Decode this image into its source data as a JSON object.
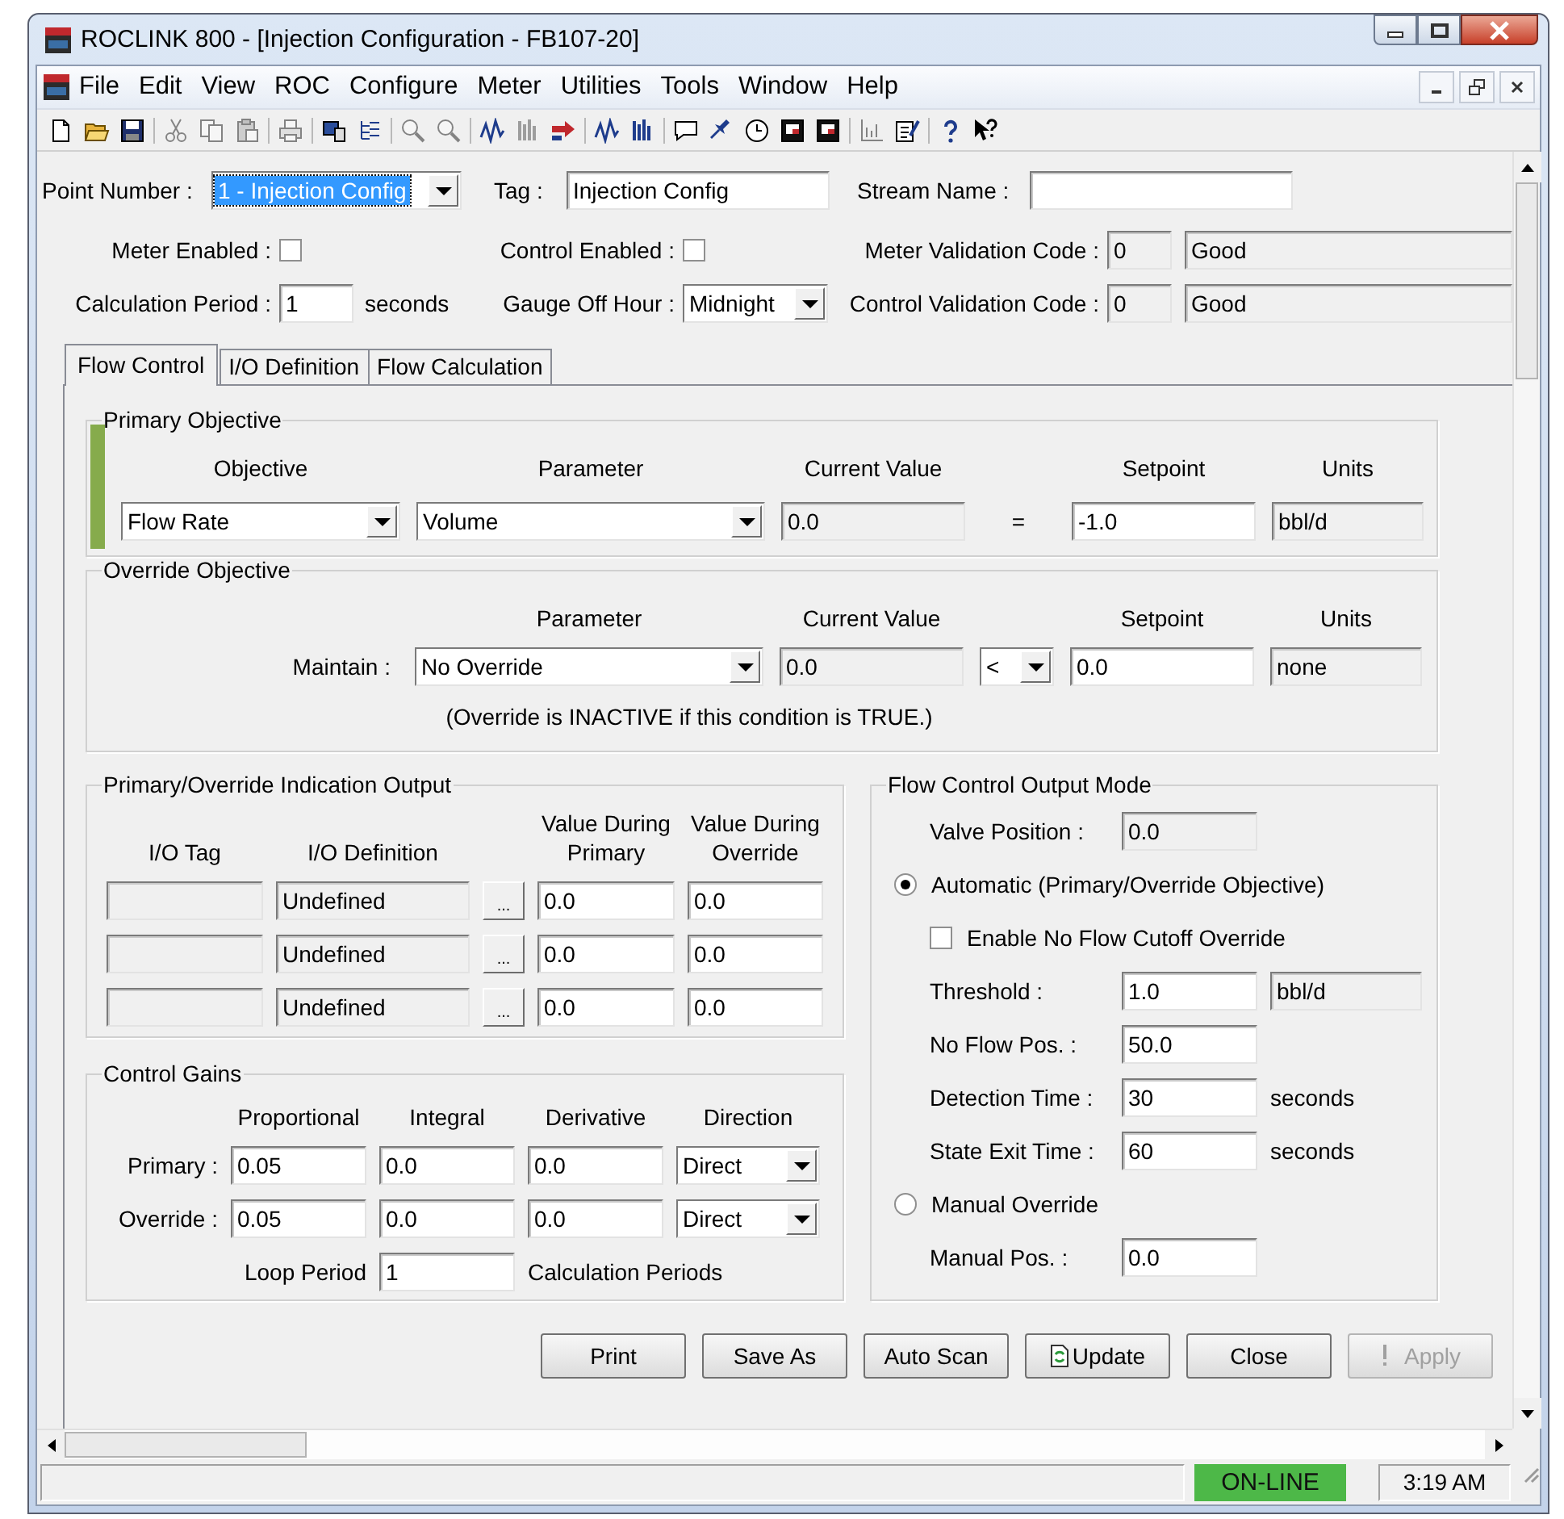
{
  "window": {
    "title": "ROCLINK 800 - [Injection Configuration - FB107-20]"
  },
  "menu": [
    "File",
    "Edit",
    "View",
    "ROC",
    "Configure",
    "Meter",
    "Utilities",
    "Tools",
    "Window",
    "Help"
  ],
  "toolbar": [
    [
      {
        "kind": "new",
        "disabled": false
      },
      {
        "kind": "open",
        "disabled": false
      },
      {
        "kind": "save",
        "disabled": false
      }
    ],
    [
      {
        "kind": "cut",
        "disabled": true
      },
      {
        "kind": "copy",
        "disabled": true
      },
      {
        "kind": "paste",
        "disabled": true
      }
    ],
    [
      {
        "kind": "print",
        "disabled": true
      }
    ],
    [
      {
        "kind": "device",
        "disabled": false
      },
      {
        "kind": "tree",
        "disabled": false
      }
    ],
    [
      {
        "kind": "zoom",
        "disabled": true
      },
      {
        "kind": "zoom",
        "disabled": true
      }
    ],
    [
      {
        "kind": "trend",
        "disabled": false
      },
      {
        "kind": "bars",
        "disabled": true
      },
      {
        "kind": "transfer",
        "disabled": false
      }
    ],
    [
      {
        "kind": "trend",
        "disabled": false
      },
      {
        "kind": "bars",
        "disabled": false
      }
    ],
    [
      {
        "kind": "chat",
        "disabled": false
      },
      {
        "kind": "plane",
        "disabled": false
      },
      {
        "kind": "clock",
        "disabled": false
      },
      {
        "kind": "monitor",
        "disabled": false
      },
      {
        "kind": "monitor",
        "disabled": false
      }
    ],
    [
      {
        "kind": "chart",
        "disabled": true
      },
      {
        "kind": "note",
        "disabled": false
      }
    ],
    [
      {
        "kind": "help",
        "disabled": false
      },
      {
        "kind": "pointer-help",
        "disabled": false
      }
    ]
  ],
  "header": {
    "point_number": {
      "label": "Point Number :",
      "value": "1 - Injection Config",
      "focused": true
    },
    "tag": {
      "label": "Tag :",
      "value": "Injection Config"
    },
    "stream_name": {
      "label": "Stream Name :"
    },
    "meter_enabled": {
      "label": "Meter Enabled :",
      "checked": false
    },
    "control_enabled": {
      "label": "Control Enabled :",
      "checked": false
    },
    "meter_validation_code": {
      "label": "Meter Validation Code :",
      "code": "0",
      "status": "Good"
    },
    "calculation_period": {
      "label": "Calculation Period :",
      "value": "1",
      "unit": "seconds"
    },
    "gauge_off_hour": {
      "label": "Gauge Off Hour :",
      "value": "Midnight"
    },
    "control_validation_code": {
      "label": "Control Validation Code :",
      "code": "0",
      "status": "Good"
    }
  },
  "tabs": [
    {
      "label": "Flow Control",
      "selected": true
    },
    {
      "label": "I/O Definition",
      "selected": false
    },
    {
      "label": "Flow Calculation",
      "selected": false
    }
  ],
  "primary_objective": {
    "title": "Primary Objective",
    "active": true,
    "columns": [
      "Objective",
      "Parameter",
      "Current Value",
      "Setpoint",
      "Units"
    ],
    "objective": "Flow Rate",
    "parameter": "Volume",
    "current_value": "0.0",
    "operator": "=",
    "setpoint": "-1.0",
    "units": "bbl/d"
  },
  "override_objective": {
    "title": "Override Objective",
    "active": false,
    "columns": [
      "Parameter",
      "Current Value",
      "Setpoint",
      "Units"
    ],
    "label": "Maintain :",
    "parameter": "No Override",
    "current_value": "0.0",
    "operator": "<",
    "setpoint": "0.0",
    "units": "none",
    "note": "(Override is INACTIVE if this condition is TRUE.)"
  },
  "indication_output": {
    "title": "Primary/Override Indication Output",
    "columns": [
      "I/O Tag",
      "I/O Definition",
      "Value During Primary",
      "Value During Override"
    ],
    "rows": [
      {
        "definition": "Undefined",
        "browse": "...",
        "primary": "0.0",
        "override": "0.0"
      },
      {
        "definition": "Undefined",
        "browse": "...",
        "primary": "0.0",
        "override": "0.0"
      },
      {
        "definition": "Undefined",
        "browse": "...",
        "primary": "0.0",
        "override": "0.0"
      }
    ]
  },
  "control_gains": {
    "title": "Control Gains",
    "columns": [
      "Proportional",
      "Integral",
      "Derivative",
      "Direction"
    ],
    "rows": [
      {
        "label": "Primary :",
        "proportional": "0.05",
        "integral": "0.0",
        "derivative": "0.0",
        "direction": "Direct"
      },
      {
        "label": "Override :",
        "proportional": "0.05",
        "integral": "0.0",
        "derivative": "0.0",
        "direction": "Direct"
      }
    ],
    "loop_period": {
      "label": "Loop Period",
      "value": "1",
      "unit": "Calculation Periods"
    }
  },
  "output_mode": {
    "title": "Flow Control Output Mode",
    "valve_position": {
      "label": "Valve Position :",
      "value": "0.0"
    },
    "modes": [
      {
        "label": "Automatic (Primary/Override Objective)",
        "selected": true
      },
      {
        "label": "Manual Override",
        "selected": false
      }
    ],
    "no_flow_cutoff": {
      "label": "Enable No Flow Cutoff Override",
      "checked": false
    },
    "settings": [
      {
        "label": "Threshold :",
        "value": "1.0",
        "unit": "bbl/d",
        "kind": "box"
      },
      {
        "label": "No Flow Pos. :",
        "value": "50.0",
        "kind": "none"
      },
      {
        "label": "Detection Time :",
        "value": "30",
        "unit": "seconds",
        "kind": "text"
      },
      {
        "label": "State Exit Time :",
        "value": "60",
        "unit": "seconds",
        "kind": "text"
      }
    ],
    "manual_position": {
      "label": "Manual Pos. :",
      "value": "0.0"
    }
  },
  "buttons": [
    {
      "label": "Print",
      "kind": "plain",
      "disabled": false
    },
    {
      "label": "Save As",
      "kind": "plain",
      "disabled": false
    },
    {
      "label": "Auto Scan",
      "kind": "plain",
      "disabled": false
    },
    {
      "label": "Update",
      "kind": "update",
      "disabled": false
    },
    {
      "label": "Close",
      "kind": "plain",
      "disabled": false
    },
    {
      "label": "Apply",
      "kind": "apply",
      "disabled": true
    }
  ],
  "status_bar": {
    "connection": "ON-LINE",
    "time": "3:19 AM"
  }
}
